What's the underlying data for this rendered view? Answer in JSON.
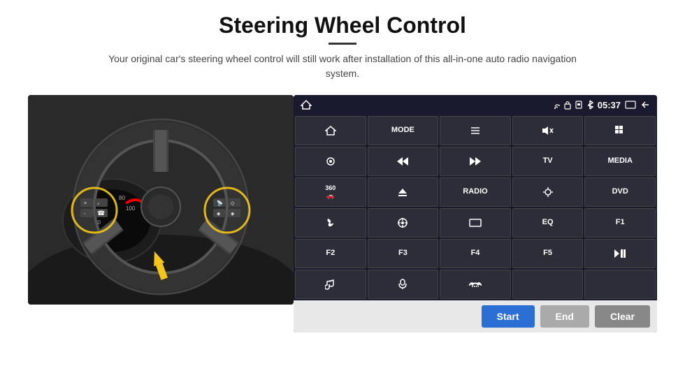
{
  "header": {
    "title": "Steering Wheel Control",
    "subtitle": "Your original car's steering wheel control will still work after installation of this all-in-one auto radio navigation system."
  },
  "status_bar": {
    "time": "05:37",
    "icons": [
      "wifi",
      "lock",
      "sim",
      "bluetooth",
      "screen",
      "back"
    ]
  },
  "grid_buttons": [
    {
      "id": "r1c1",
      "type": "icon",
      "label": "⌂",
      "icon": "home"
    },
    {
      "id": "r1c2",
      "type": "text",
      "label": "MODE"
    },
    {
      "id": "r1c3",
      "type": "icon",
      "label": "≡",
      "icon": "list"
    },
    {
      "id": "r1c4",
      "type": "icon",
      "label": "🔇",
      "icon": "mute"
    },
    {
      "id": "r1c5",
      "type": "icon",
      "label": "⠿",
      "icon": "apps"
    },
    {
      "id": "r2c1",
      "type": "icon",
      "label": "⊙",
      "icon": "settings"
    },
    {
      "id": "r2c2",
      "type": "icon",
      "label": "⏮",
      "icon": "prev"
    },
    {
      "id": "r2c3",
      "type": "icon",
      "label": "⏭",
      "icon": "next"
    },
    {
      "id": "r2c4",
      "type": "text",
      "label": "TV"
    },
    {
      "id": "r2c5",
      "type": "text",
      "label": "MEDIA"
    },
    {
      "id": "r3c1",
      "type": "icon",
      "label": "🚗",
      "icon": "360"
    },
    {
      "id": "r3c2",
      "type": "icon",
      "label": "▲",
      "icon": "eject"
    },
    {
      "id": "r3c3",
      "type": "text",
      "label": "RADIO"
    },
    {
      "id": "r3c4",
      "type": "icon",
      "label": "☀",
      "icon": "brightness"
    },
    {
      "id": "r3c5",
      "type": "text",
      "label": "DVD"
    },
    {
      "id": "r4c1",
      "type": "icon",
      "label": "📞",
      "icon": "phone"
    },
    {
      "id": "r4c2",
      "type": "icon",
      "label": "◉",
      "icon": "gps"
    },
    {
      "id": "r4c3",
      "type": "icon",
      "label": "▬",
      "icon": "display"
    },
    {
      "id": "r4c4",
      "type": "text",
      "label": "EQ"
    },
    {
      "id": "r4c5",
      "type": "text",
      "label": "F1"
    },
    {
      "id": "r5c1",
      "type": "text",
      "label": "F2"
    },
    {
      "id": "r5c2",
      "type": "text",
      "label": "F3"
    },
    {
      "id": "r5c3",
      "type": "text",
      "label": "F4"
    },
    {
      "id": "r5c4",
      "type": "text",
      "label": "F5"
    },
    {
      "id": "r5c5",
      "type": "icon",
      "label": "⏯",
      "icon": "playpause"
    },
    {
      "id": "r6c1",
      "type": "icon",
      "label": "♫",
      "icon": "music"
    },
    {
      "id": "r6c2",
      "type": "icon",
      "label": "🎤",
      "icon": "mic"
    },
    {
      "id": "r6c3",
      "type": "icon",
      "label": "📵",
      "icon": "hangup"
    },
    {
      "id": "r6c4",
      "type": "text",
      "label": ""
    },
    {
      "id": "r6c5",
      "type": "text",
      "label": ""
    }
  ],
  "bottom_buttons": {
    "start": "Start",
    "end": "End",
    "clear": "Clear"
  }
}
